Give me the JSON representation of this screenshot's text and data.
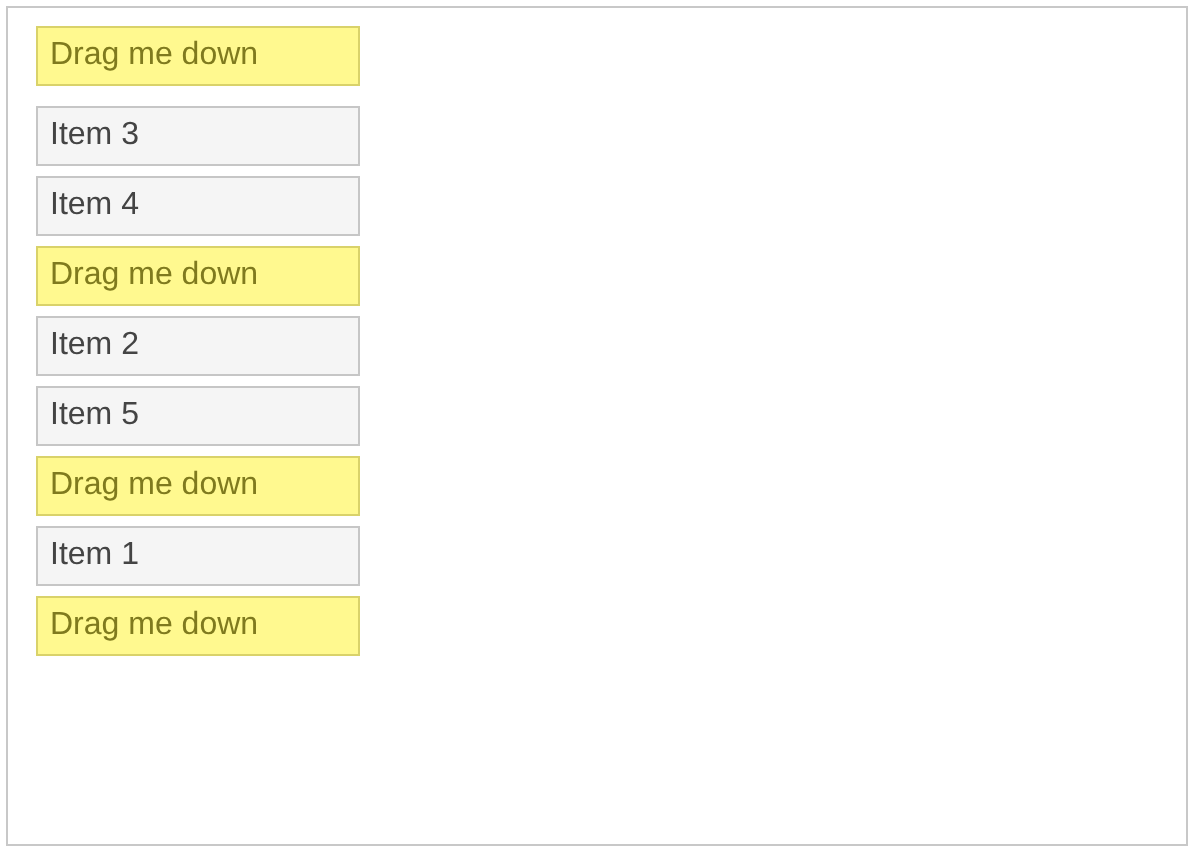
{
  "header_item": {
    "label": "Drag me down",
    "kind": "highlight"
  },
  "items": [
    {
      "label": "Item 3",
      "kind": "plain"
    },
    {
      "label": "Item 4",
      "kind": "plain"
    },
    {
      "label": "Drag me down",
      "kind": "highlight"
    },
    {
      "label": "Item 2",
      "kind": "plain"
    },
    {
      "label": "Item 5",
      "kind": "plain"
    },
    {
      "label": "Drag me down",
      "kind": "highlight"
    },
    {
      "label": "Item 1",
      "kind": "plain"
    },
    {
      "label": "Drag me down",
      "kind": "highlight"
    }
  ]
}
